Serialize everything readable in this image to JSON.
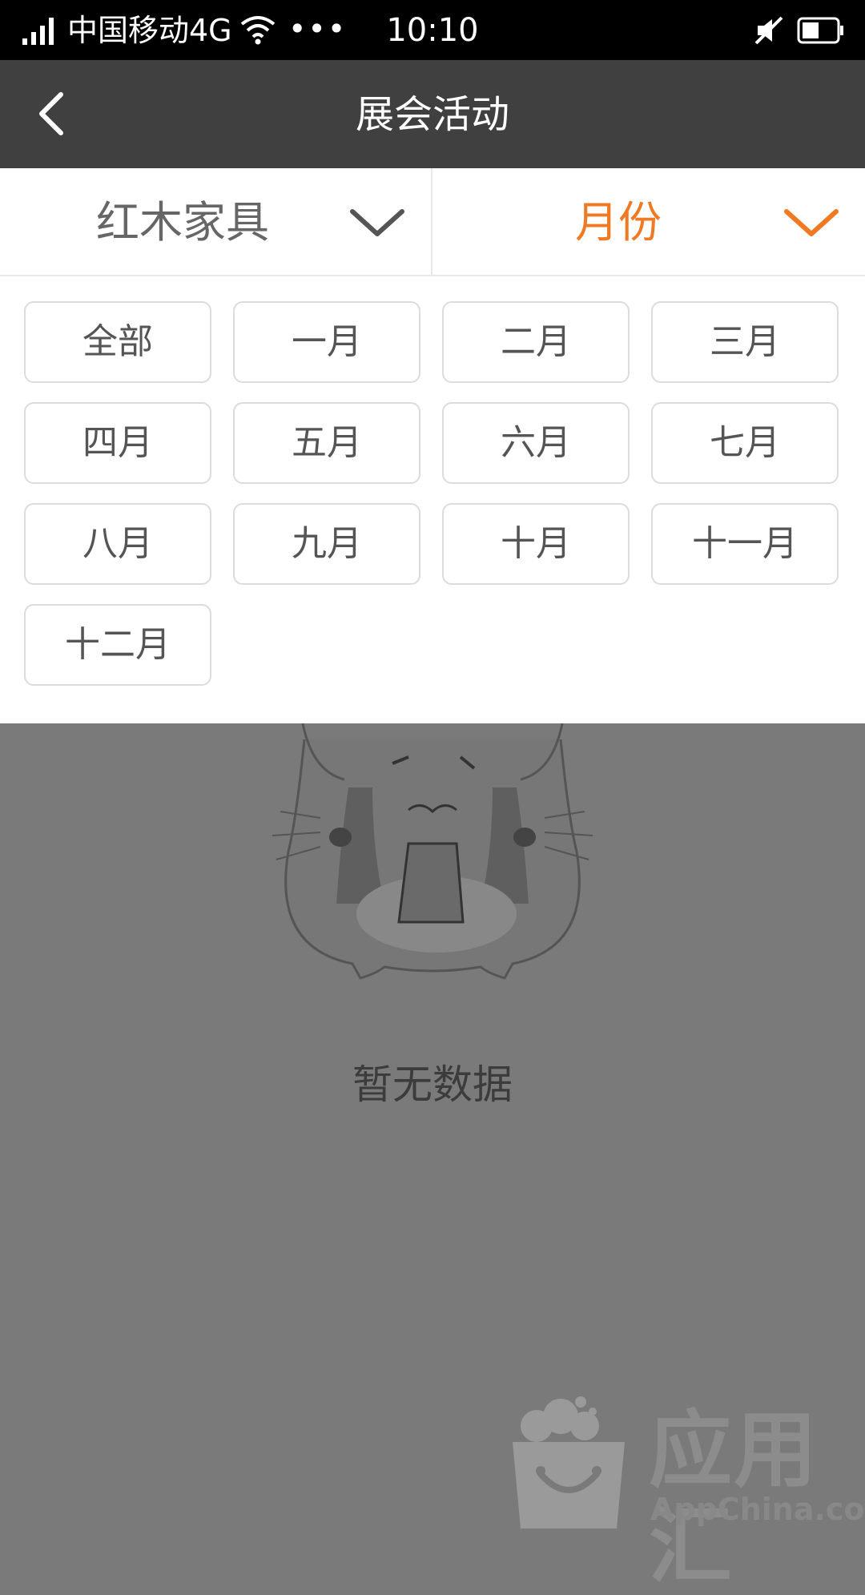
{
  "status_bar": {
    "carrier": "中国移动4G",
    "dots": "•••",
    "time": "10:10",
    "icons": [
      "signal-icon",
      "wifi-icon",
      "mute-icon",
      "battery-icon"
    ]
  },
  "nav": {
    "back_icon": "chevron-left-icon",
    "title": "展会活动"
  },
  "filters": {
    "category_label": "红木家具",
    "month_label": "月份",
    "active_color": "#f07a24"
  },
  "months": [
    "全部",
    "一月",
    "二月",
    "三月",
    "四月",
    "五月",
    "六月",
    "七月",
    "八月",
    "九月",
    "十月",
    "十一月",
    "十二月"
  ],
  "empty_state": {
    "icon": "crying-hamster-illustration",
    "text": "暂无数据"
  },
  "watermark": {
    "icon": "shopping-bag-logo-icon",
    "text": "应用汇",
    "subtext": "AppChina.com"
  }
}
